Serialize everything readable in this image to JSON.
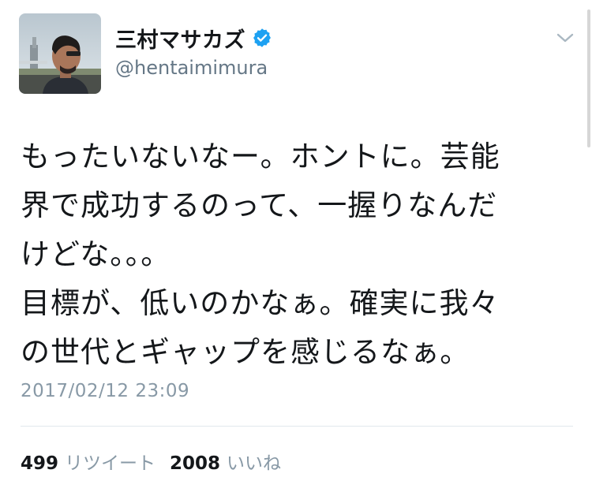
{
  "tweet": {
    "author": {
      "display_name": "三村マサカズ",
      "verified": true,
      "handle": "@hentaimimura",
      "avatar_icon": "profile-photo"
    },
    "menu_icon": "chevron-down-icon",
    "text": "もったいないなー。ホントに。芸能\n界で成功するのって、一握りなんだ\nけどな。。。\n目標が、低いのかなぁ。確実に我々\nの世代とギャップを感じるなぁ。",
    "timestamp": "2017/02/12 23:09",
    "stats": {
      "retweets_count": "499",
      "retweets_label": "リツイート",
      "likes_count": "2008",
      "likes_label": "いいね"
    }
  },
  "colors": {
    "text_primary": "#14171a",
    "text_secondary": "#657786",
    "timestamp": "#8899a6",
    "verified_blue": "#1da1f2",
    "divider": "#e1e8ed"
  }
}
